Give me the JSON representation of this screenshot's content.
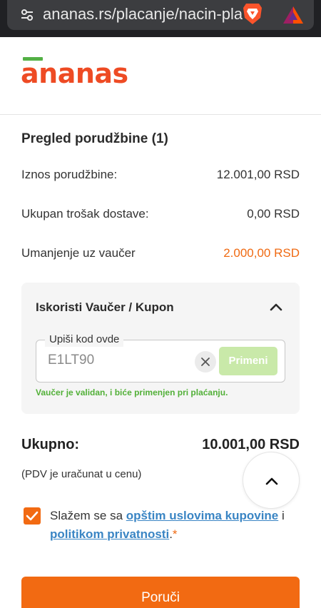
{
  "browser": {
    "url": "ananas.rs/placanje/nacin-placa",
    "site_settings_icon": "tune-icon",
    "shield_icon": "brave-lion-icon",
    "rewards_icon": "bat-triangle-icon"
  },
  "header": {
    "logo_text": "ananas"
  },
  "summary": {
    "title": "Pregled porudžbine (1)",
    "rows": [
      {
        "label": "Iznos porudžbine:",
        "value": "12.001,00 RSD"
      },
      {
        "label": "Ukupan trošak dostave:",
        "value": "0,00 RSD"
      },
      {
        "label": "Umanjenje uz vaučer",
        "value": "2.000,00 RSD"
      }
    ]
  },
  "voucher": {
    "title": "Iskoristi Vaučer / Kupon",
    "field_label": "Upiši kod ovde",
    "field_value": "E1LT90",
    "apply_label": "Primeni",
    "message": "Vaučer je validan, i biće primenjen pri plaćanju."
  },
  "total": {
    "label": "Ukupno:",
    "value": "10.001,00 RSD",
    "vat_note": "(PDV je uračunat u cenu)"
  },
  "terms": {
    "checked": true,
    "prefix": "Slažem se sa ",
    "link1": "opštim uslovima kupovine",
    "middle": " i ",
    "link2": "politikom privatnosti",
    "suffix": ".",
    "required_mark": "*"
  },
  "order_button": {
    "label": "Poruči"
  },
  "colors": {
    "brand_orange": "#f26a12",
    "brand_green": "#53b045",
    "link_blue": "#3a85c4",
    "valid_green": "#52b038"
  }
}
